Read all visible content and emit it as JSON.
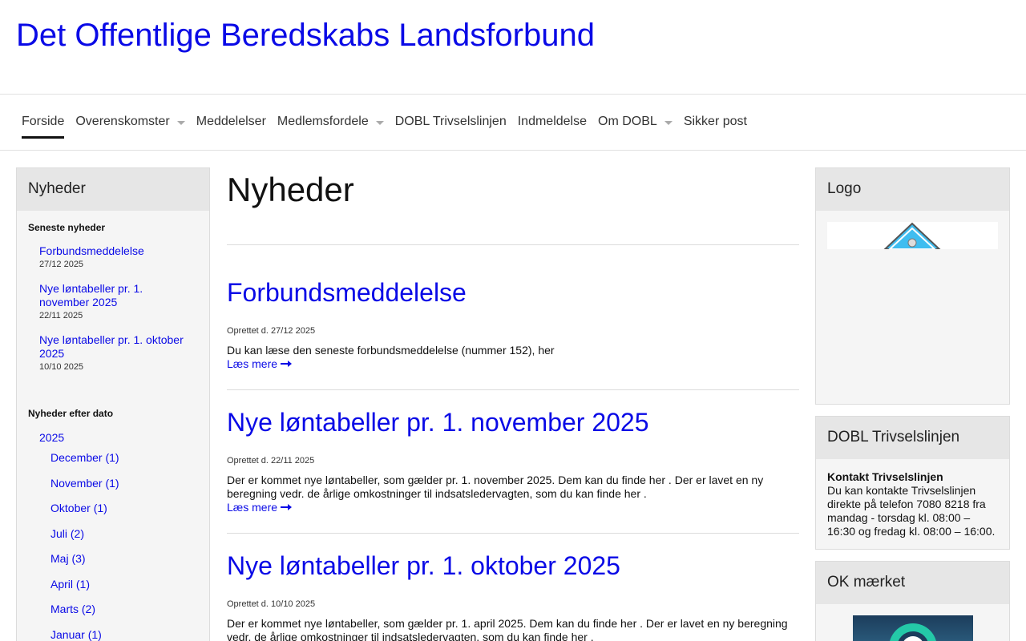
{
  "site": {
    "title": "Det Offentlige Beredskabs Landsforbund"
  },
  "nav": {
    "items": [
      {
        "label": "Forside"
      },
      {
        "label": "Overenskomster"
      },
      {
        "label": "Meddelelser"
      },
      {
        "label": "Medlemsfordele"
      },
      {
        "label": "DOBL Trivselslinjen"
      },
      {
        "label": "Indmeldelse"
      },
      {
        "label": "Om DOBL"
      },
      {
        "label": "Sikker post"
      }
    ]
  },
  "left": {
    "heading": "Nyheder",
    "latest_label": "Seneste nyheder",
    "latest": [
      {
        "title": "Forbundsmeddelelse",
        "date": "27/12 2025"
      },
      {
        "title": "Nye løntabeller pr. 1. november 2025",
        "date": "22/11 2025"
      },
      {
        "title": "Nye løntabeller pr. 1. oktober 2025",
        "date": "10/10 2025"
      }
    ],
    "by_date_label": "Nyheder efter dato",
    "year": "2025",
    "months": [
      "December (1)",
      "November (1)",
      "Oktober (1)",
      "Juli (2)",
      "Maj (3)",
      "April (1)",
      "Marts (2)",
      "Januar (1)"
    ]
  },
  "main": {
    "heading": "Nyheder",
    "read_more": "Læs mere",
    "articles": [
      {
        "title": "Forbundsmeddelelse",
        "meta": "Oprettet d. 27/12 2025",
        "body": "Du kan læse den seneste forbundsmeddelelse (nummer 152), her"
      },
      {
        "title": "Nye løntabeller pr. 1. november 2025",
        "meta": "Oprettet d. 22/11 2025",
        "body": "Der er kommet nye løntabeller, som gælder pr. 1. november 2025. Dem kan du finde  her . Der er lavet en ny beregning vedr. de årlige omkostninger til indsatsledervagten, som du kan finde  her ."
      },
      {
        "title": "Nye løntabeller pr. 1. oktober 2025",
        "meta": "Oprettet d. 10/10 2025",
        "body": "Der er kommet nye løntabeller, som gælder pr. 1. april 2025. Dem kan du finde  her . Der er lavet en ny beregning vedr. de årlige omkostninger til indsatsledervagten, som du kan finde  her ."
      }
    ]
  },
  "right": {
    "logo_heading": "Logo",
    "trivsel_heading": "DOBL Trivselslinjen",
    "trivsel_title": "Kontakt Trivselslinjen",
    "trivsel_text": "Du kan  kontakte Trivselslinjen direkte på telefon 7080 8218 fra mandag - torsdag kl. 08:00 – 16:30 og fredag kl. 08:00 – 16:00.",
    "ok_heading": "OK mærket"
  }
}
